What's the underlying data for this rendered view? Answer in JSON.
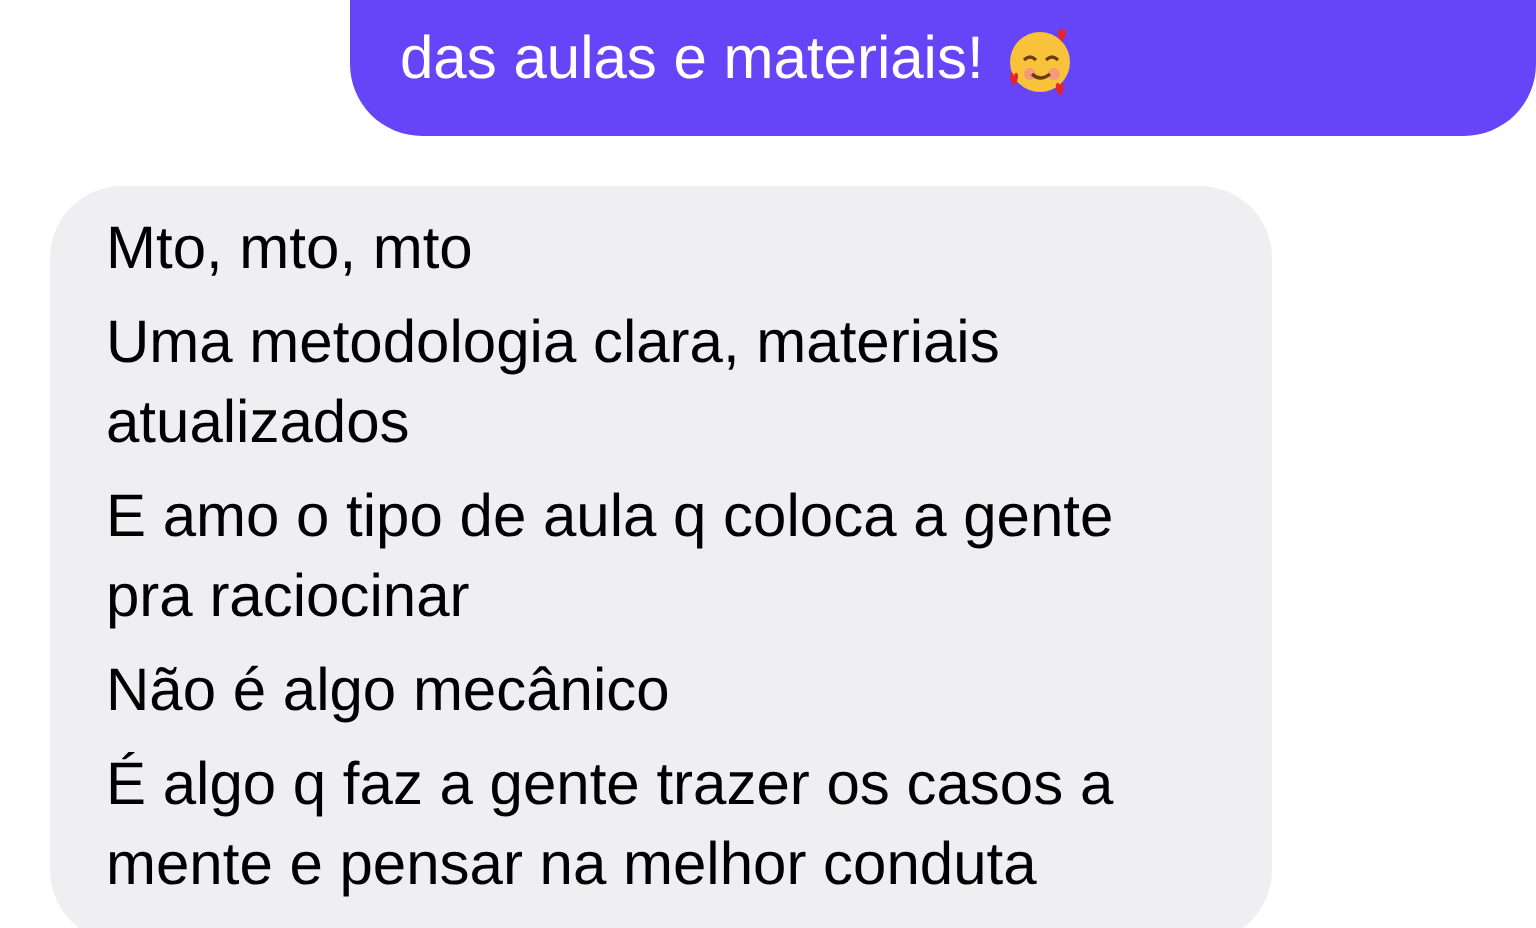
{
  "messages": [
    {
      "kind": "sent",
      "paragraphs": [
        [
          "das aulas e materiais!"
        ]
      ],
      "trailing_emoji": true
    },
    {
      "kind": "received",
      "paragraphs": [
        [
          "Mto, mto, mto"
        ],
        [
          "Uma metodologia clara, materiais",
          "atualizados"
        ],
        [
          "E amo o tipo de aula q coloca a gente",
          "pra raciocinar"
        ],
        [
          "Não é algo mecânico"
        ],
        [
          "É algo q faz a gente trazer os casos a",
          "mente e pensar na melhor conduta"
        ]
      ]
    }
  ]
}
